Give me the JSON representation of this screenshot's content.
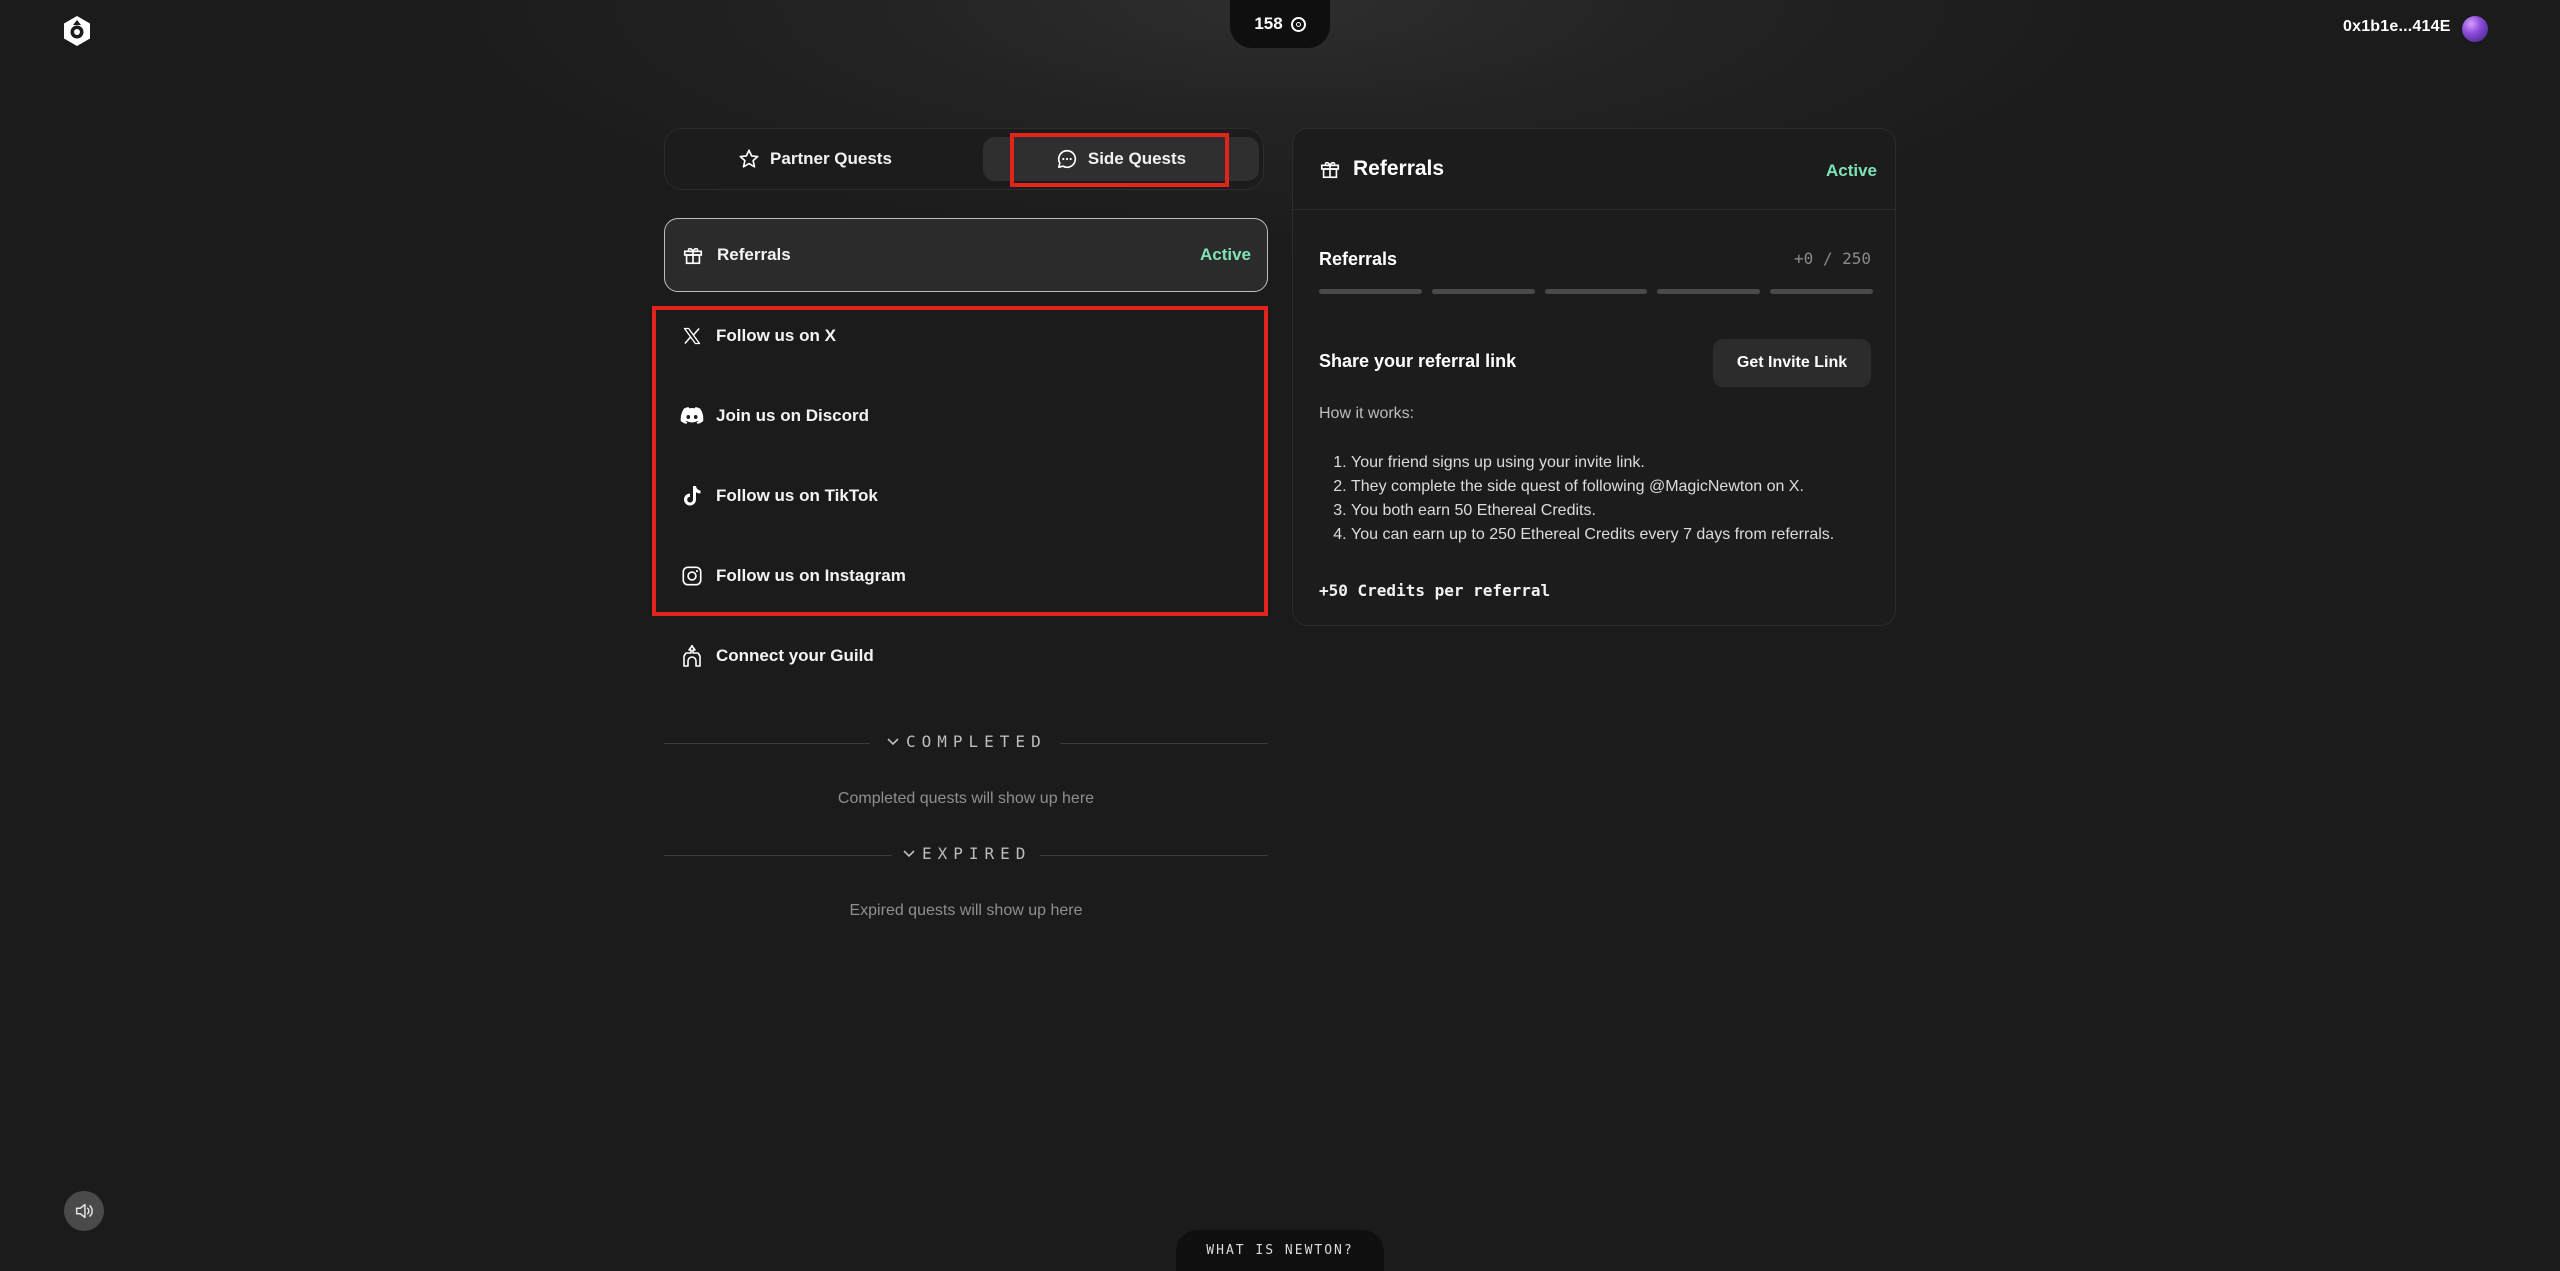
{
  "header": {
    "credits": "158",
    "wallet_address": "0x1b1e...414E"
  },
  "tabs": [
    {
      "label": "Partner Quests",
      "icon": "star-icon"
    },
    {
      "label": "Side Quests",
      "icon": "chat-bubble-icon",
      "selected": true
    }
  ],
  "quests": {
    "active": {
      "label": "Referrals",
      "status": "Active",
      "icon": "gift-icon"
    },
    "items": [
      {
        "label": "Follow us on X",
        "icon": "x-logo-icon"
      },
      {
        "label": "Join us on Discord",
        "icon": "discord-icon"
      },
      {
        "label": "Follow us on TikTok",
        "icon": "tiktok-icon"
      },
      {
        "label": "Follow us on Instagram",
        "icon": "instagram-icon"
      },
      {
        "label": "Connect your Guild",
        "icon": "guild-castle-icon"
      }
    ]
  },
  "sections": {
    "completed_title": "COMPLETED",
    "completed_empty": "Completed quests will show up here",
    "expired_title": "EXPIRED",
    "expired_empty": "Expired quests will show up here"
  },
  "detail": {
    "title": "Referrals",
    "status": "Active",
    "progress_label": "Referrals",
    "progress_count": "+0 / 250",
    "progress_segments": 5,
    "progress_value": 0,
    "share_title": "Share your referral link",
    "invite_button": "Get Invite Link",
    "how_it_works": "How it works:",
    "steps": [
      "Your friend signs up using your invite link.",
      "They complete the side quest of following @MagicNewton on X.",
      "You both earn 50 Ethereal Credits.",
      "You can earn up to 250 Ethereal Credits every 7 days from referrals."
    ],
    "reward": "+50 Credits per referral"
  },
  "footer": {
    "what_is": "WHAT IS NEWTON?"
  },
  "colors": {
    "background": "#1b1b1b",
    "active_green": "#7fe3b8",
    "highlight_red": "#e3231c"
  }
}
